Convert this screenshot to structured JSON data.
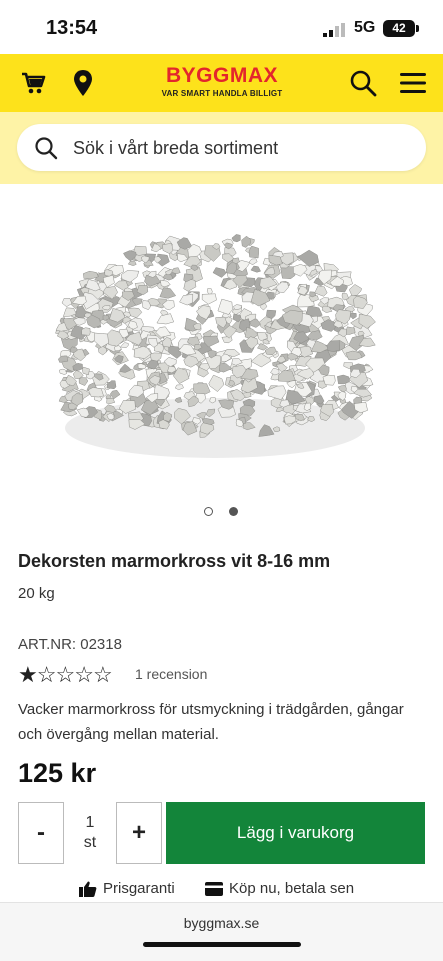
{
  "status": {
    "time": "13:54",
    "network": "5G",
    "battery": "42"
  },
  "header": {
    "logo_text": "BYGGMAX",
    "tagline": "VAR SMART HANDLA BILLIGT",
    "icons": [
      "cart-icon",
      "location-pin-icon",
      "search-icon",
      "menu-icon"
    ],
    "colors": {
      "header_bg": "#FDE21B",
      "logo": "#E3262C",
      "search_band": "#FEF3A6"
    }
  },
  "search": {
    "placeholder": "Sök i vårt breda sortiment"
  },
  "carousel": {
    "total": 2,
    "active_index": 1
  },
  "product": {
    "title": "Dekorsten marmorkross vit 8-16 mm",
    "weight": "20 kg",
    "art_nr": "ART.NR: 02318",
    "rating": 1,
    "rating_max": 5,
    "reviews": "1 recension",
    "description": "Vacker marmorkross för utsmyckning i trädgården, gångar och övergång mellan material.",
    "price": "125 kr"
  },
  "purchase": {
    "minus_label": "-",
    "plus_label": "+",
    "qty": "1",
    "unit": "st",
    "add_to_cart": "Lägg i varukorg",
    "button_color": "#13853A"
  },
  "guarantees": {
    "price_guarantee": "Prisgaranti",
    "pay_later": "Köp nu, betala sen"
  },
  "browser": {
    "url": "byggmax.se"
  }
}
